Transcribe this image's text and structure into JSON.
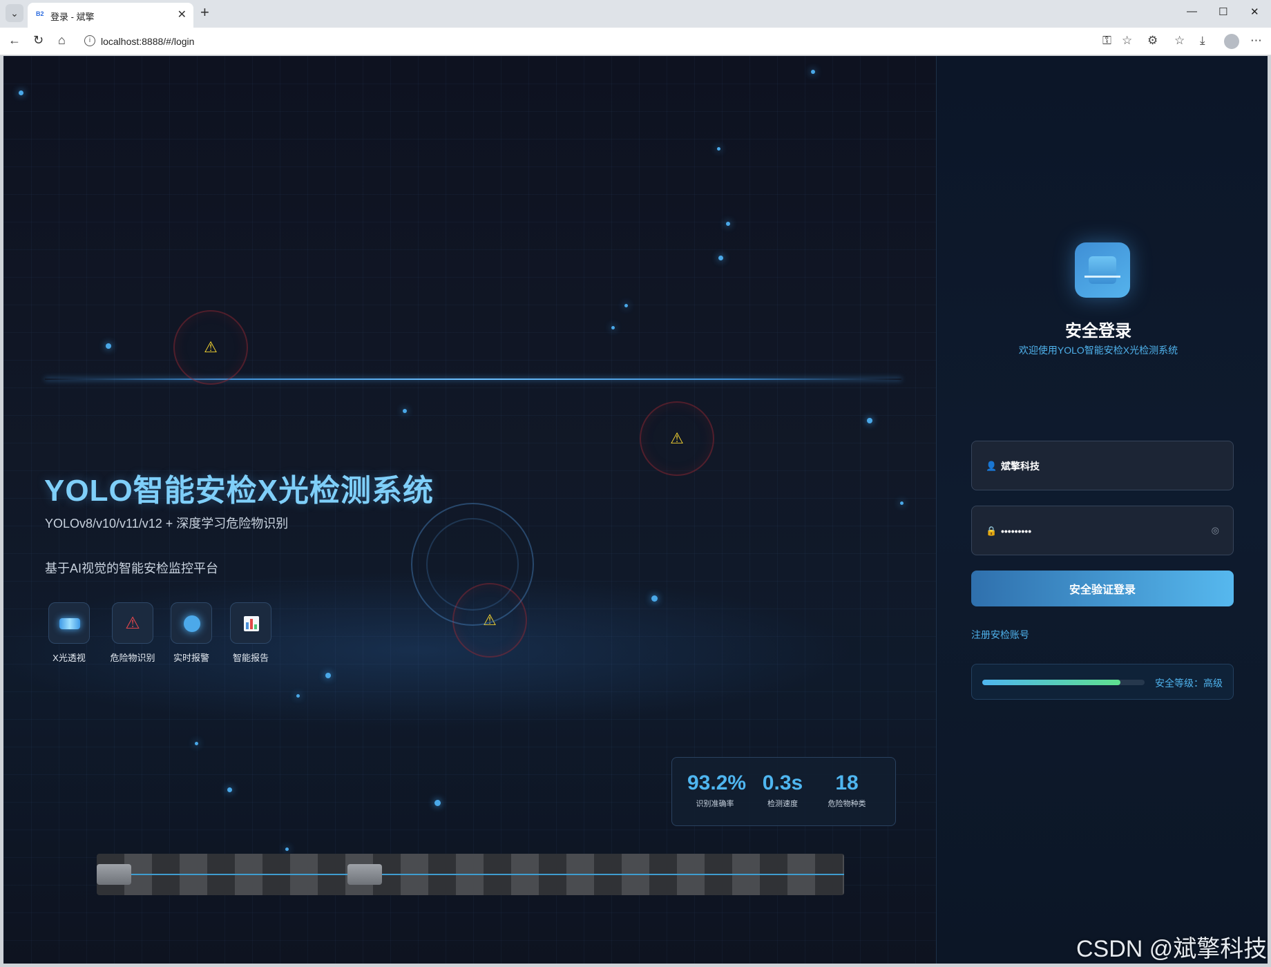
{
  "browser": {
    "tab_title": "登录 - 斌擎",
    "tab_favicon": "B2",
    "url": "localhost:8888/#/login"
  },
  "hero": {
    "title": "YOLO智能安检X光检测系统",
    "subtitle": "YOLOv8/v10/v11/v12 + 深度学习危险物识别",
    "description": "基于AI视觉的智能安检监控平台"
  },
  "features": [
    {
      "label": "X光透视",
      "icon": "xray-icon"
    },
    {
      "label": "危险物识别",
      "icon": "warning-icon"
    },
    {
      "label": "实时报警",
      "icon": "alarm-icon"
    },
    {
      "label": "智能报告",
      "icon": "report-icon"
    }
  ],
  "stats": [
    {
      "value": "93.2%",
      "label": "识别准确率"
    },
    {
      "value": "0.3s",
      "label": "检测速度"
    },
    {
      "value": "18",
      "label": "危险物种类"
    }
  ],
  "login": {
    "title": "安全登录",
    "subtitle": "欢迎使用YOLO智能安检X光检测系统",
    "username": "斌擎科技",
    "password": "•••••••••",
    "submit_label": "安全验证登录",
    "register_label": "注册安检账号",
    "security_label": "安全等级：高级",
    "security_level": 0.85
  },
  "colors": {
    "accent": "#4fb6f0",
    "background": "#0d1321",
    "hazard": "#f2d231"
  },
  "watermark": "CSDN @斌擎科技"
}
